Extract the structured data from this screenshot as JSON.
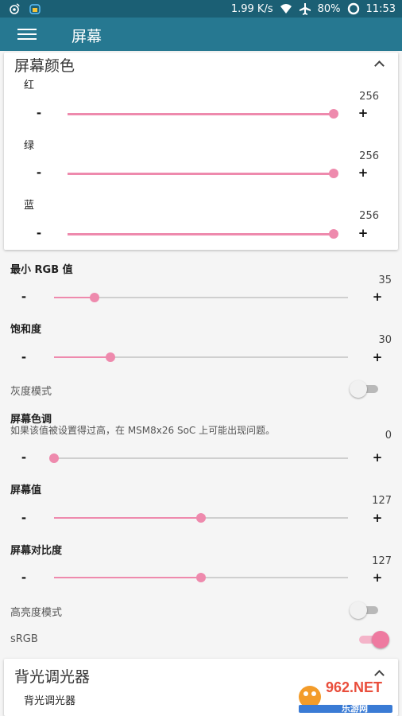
{
  "status": {
    "speed": "1.99 K/s",
    "battery": "80%",
    "time": "11:53"
  },
  "appbar": {
    "title": "屏幕"
  },
  "color_card": {
    "title": "屏幕颜色",
    "red": {
      "label": "红",
      "value": "256",
      "level": 1.0
    },
    "green": {
      "label": "绿",
      "value": "256",
      "level": 1.0
    },
    "blue": {
      "label": "蓝",
      "value": "256",
      "level": 1.0
    }
  },
  "controls": {
    "minus": "-",
    "plus": "+"
  },
  "min_rgb": {
    "label": "最小 RGB 值",
    "value": "35",
    "level": 0.137
  },
  "saturation": {
    "label": "饱和度",
    "value": "30",
    "level": 0.192
  },
  "grayscale": {
    "label": "灰度模式",
    "on": false
  },
  "hue": {
    "label": "屏幕色调",
    "desc": "如果该值被设置得过高，在 MSM8x26 SoC 上可能出现问题。",
    "value": "0",
    "level": 0.0
  },
  "screen_value": {
    "label": "屏幕值",
    "value": "127",
    "level": 0.5
  },
  "contrast": {
    "label": "屏幕对比度",
    "value": "127",
    "level": 0.5
  },
  "high_brightness": {
    "label": "高亮度模式",
    "on": false
  },
  "srgb": {
    "label": "sRGB",
    "on": true
  },
  "backlight_card": {
    "title": "背光调光器",
    "item": "背光调光器"
  },
  "watermark": {
    "brand": "962.NET",
    "sub": "乐游网"
  },
  "colors": {
    "statusbar": "#1b5f74",
    "appbar": "#267891",
    "accent": "#ee8aad"
  }
}
